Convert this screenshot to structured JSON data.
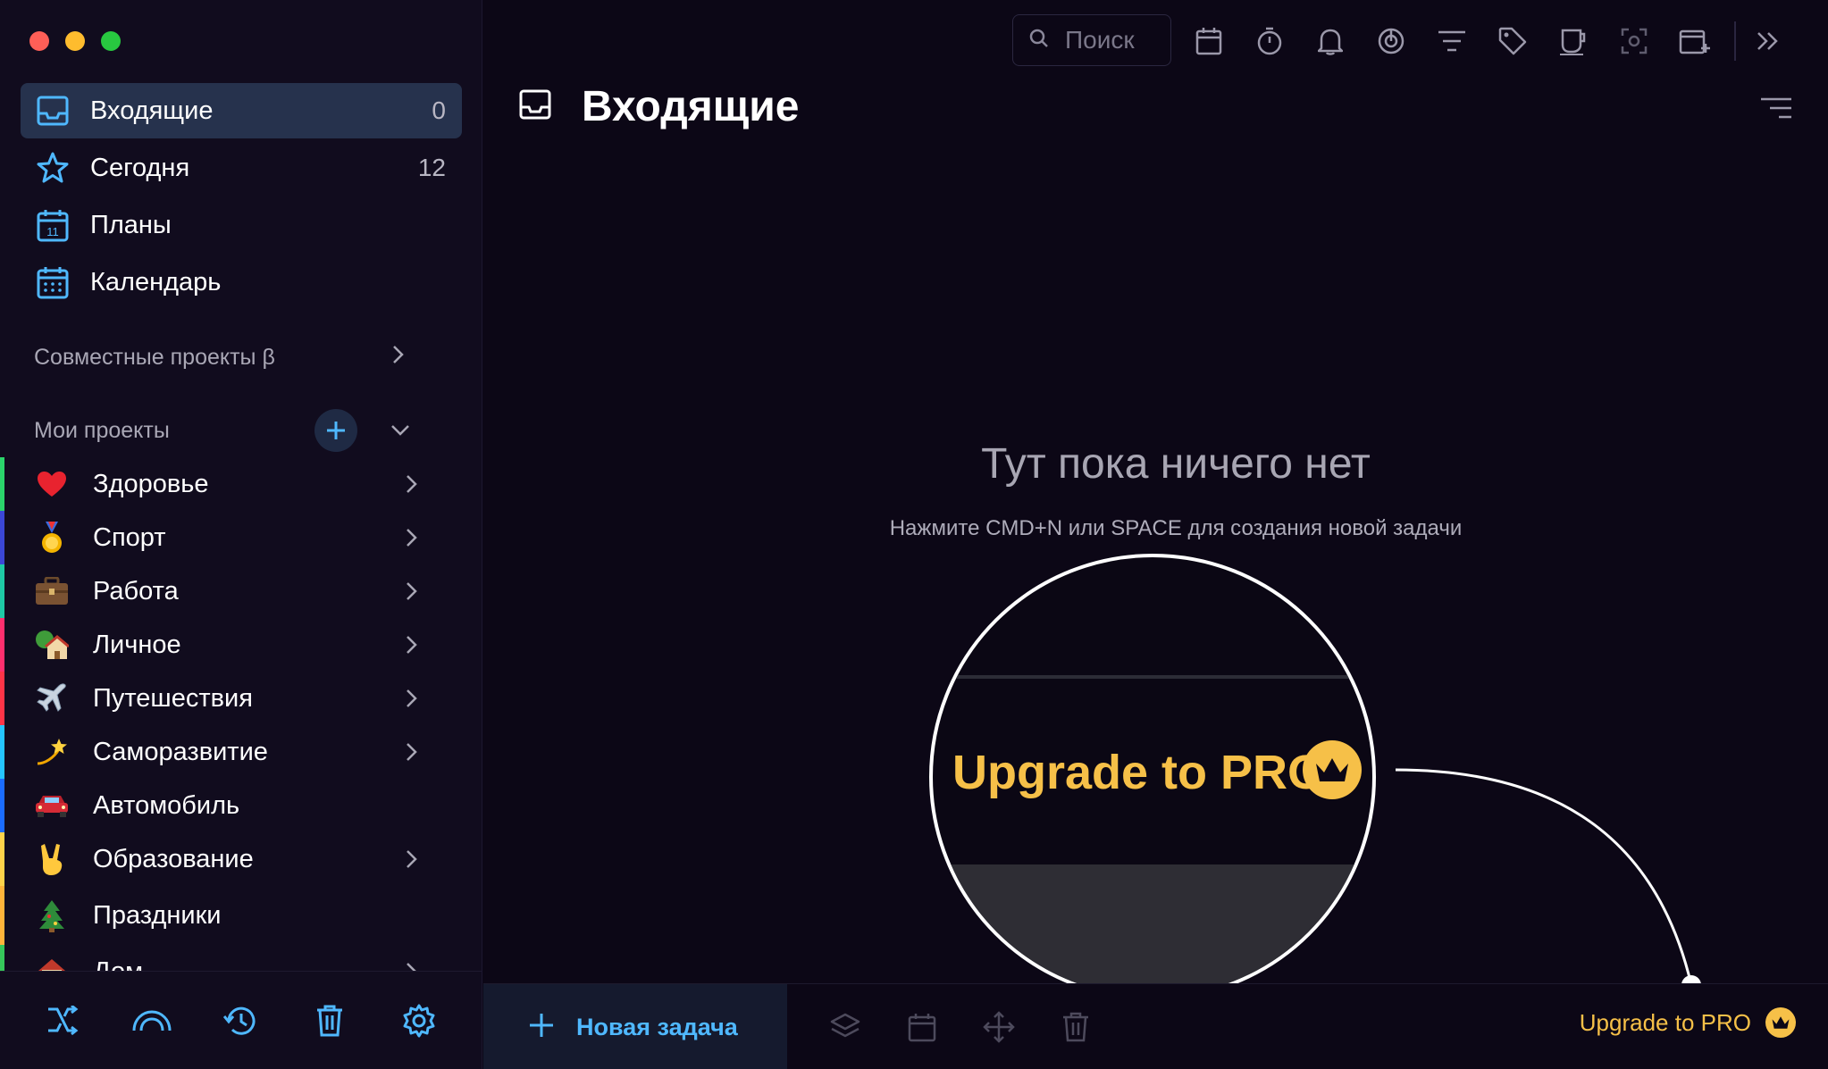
{
  "colors": {
    "accent": "#4fb8ff",
    "pro": "#f6c048",
    "active_bg": "#26324d"
  },
  "sidebar": {
    "nav": [
      {
        "label": "Входящие",
        "count": "0",
        "icon": "inbox-icon"
      },
      {
        "label": "Сегодня",
        "count": "12",
        "icon": "star-icon"
      },
      {
        "label": "Планы",
        "count": "",
        "icon": "plans-calendar-icon"
      },
      {
        "label": "Календарь",
        "count": "",
        "icon": "calendar-grid-icon"
      }
    ],
    "shared_section": "Совместные проекты β",
    "my_section": "Мои проекты",
    "projects": [
      {
        "label": "Здоровье",
        "emoji": "heart-icon",
        "color": "#2bd46b"
      },
      {
        "label": "Спорт",
        "emoji": "medal-icon",
        "color": "#3b47d6"
      },
      {
        "label": "Работа",
        "emoji": "briefcase-icon",
        "color": "#1ec9a5"
      },
      {
        "label": "Личное",
        "emoji": "house-icon",
        "color": "#ff2f6e"
      },
      {
        "label": "Путешествия",
        "emoji": "airplane-icon",
        "color": "#ff3447"
      },
      {
        "label": "Саморазвитие",
        "emoji": "dizzy-star-icon",
        "color": "#25c5ff"
      },
      {
        "label": "Автомобиль",
        "emoji": "car-icon",
        "color": "#1b6cff"
      },
      {
        "label": "Образование",
        "emoji": "victory-hand-icon",
        "color": "#ffd34a"
      },
      {
        "label": "Праздники",
        "emoji": "tree-icon",
        "color": "#ffb43a"
      },
      {
        "label": "Дом",
        "emoji": "home-icon",
        "color": "#36c75a"
      }
    ]
  },
  "header": {
    "search_placeholder": "Поиск",
    "title": "Входящие"
  },
  "empty": {
    "title": "Тут пока ничего нет",
    "hint": "Нажмите CMD+N или SPACE для создания новой задачи"
  },
  "zoom": {
    "label": "Upgrade to PRO"
  },
  "bottom": {
    "new_task": "Новая задача",
    "upgrade": "Upgrade to PRO"
  }
}
